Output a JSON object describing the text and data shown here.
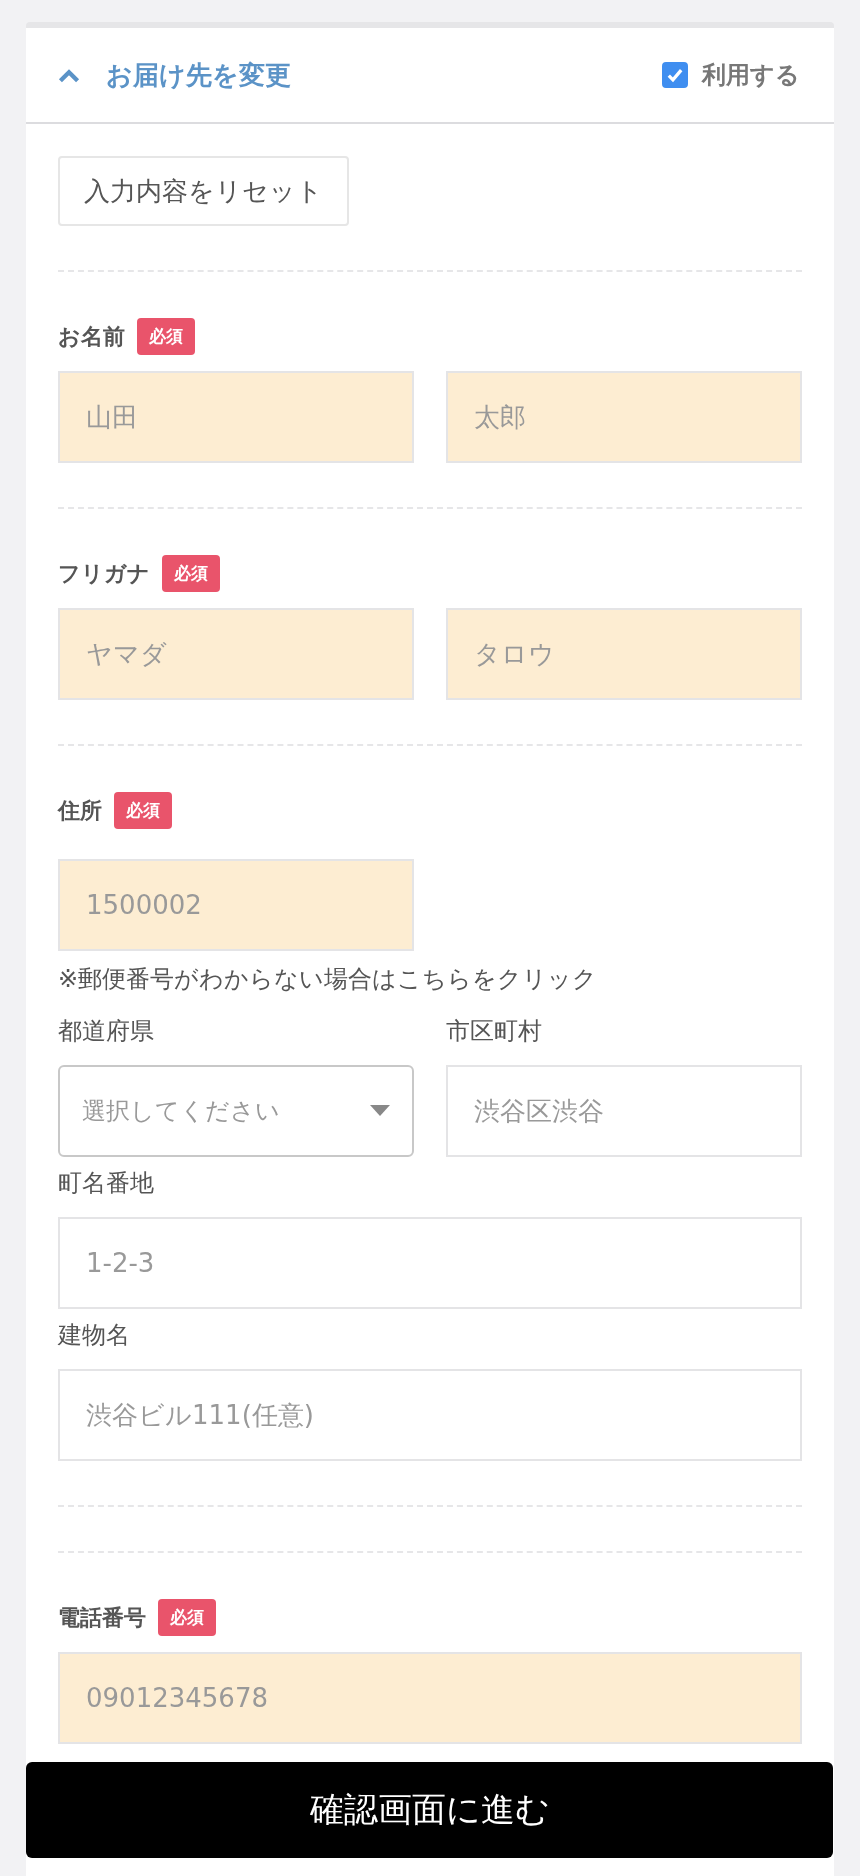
{
  "section": {
    "title": "お届け先を変更",
    "expanded": true,
    "use_checkbox": {
      "label": "利用する",
      "checked": true
    }
  },
  "reset_button": "入力内容をリセット",
  "groups": [
    {
      "label": "お名前",
      "required_badge": "必須",
      "fields": [
        {
          "placeholder": "山田",
          "required": true
        },
        {
          "placeholder": "太郎",
          "required": true
        }
      ]
    },
    {
      "label": "フリガナ",
      "required_badge": "必須",
      "fields": [
        {
          "placeholder": "ヤマダ",
          "required": true
        },
        {
          "placeholder": "タロウ",
          "required": true
        }
      ]
    }
  ],
  "address": {
    "label": "住所",
    "required_badge": "必須",
    "postal": {
      "placeholder": "1500002",
      "required": true
    },
    "postal_note": "※郵便番号がわからない場合はこちらをクリック",
    "prefecture": {
      "label": "都道府県",
      "placeholder": "選択してください"
    },
    "city": {
      "label": "市区町村",
      "placeholder": "渋谷区渋谷",
      "required": false
    },
    "street": {
      "label": "町名番地",
      "placeholder": "1-2-3",
      "required": false
    },
    "building": {
      "label": "建物名",
      "placeholder": "渋谷ビル111(任意)",
      "required": false
    }
  },
  "phone": {
    "label": "電話番号",
    "required_badge": "必須",
    "field": {
      "placeholder": "09012345678",
      "required": true
    }
  },
  "submit_button": "確認画面に進む"
}
